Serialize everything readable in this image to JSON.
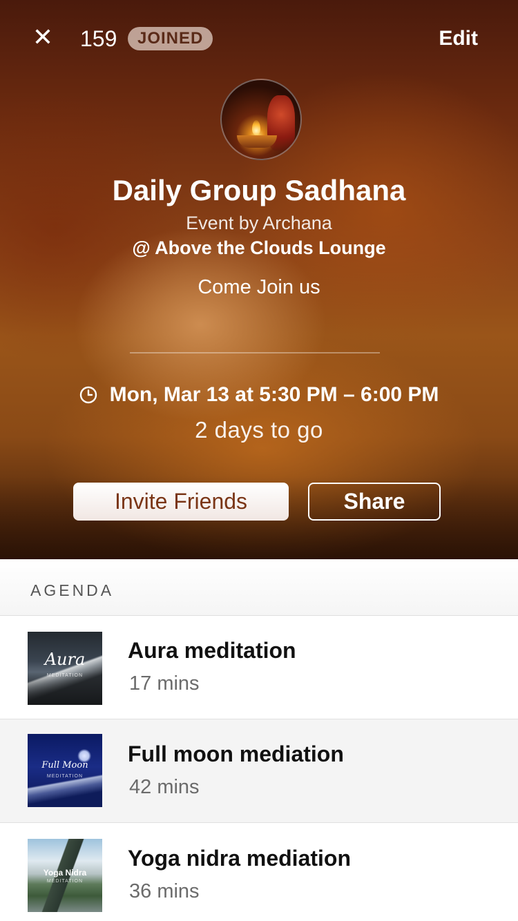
{
  "header": {
    "close_glyph": "✕",
    "member_count": "159",
    "joined_label": "JOINED",
    "edit_label": "Edit"
  },
  "event": {
    "title": "Daily Group Sadhana",
    "by_line": "Event by Archana",
    "location": "@ Above the Clouds Lounge",
    "description": "Come Join us",
    "datetime": "Mon, Mar 13 at 5:30 PM – 6:00 PM",
    "countdown": "2 days to go"
  },
  "actions": {
    "invite_label": "Invite Friends",
    "share_label": "Share"
  },
  "agenda": {
    "heading": "AGENDA",
    "items": [
      {
        "title": "Aura meditation",
        "duration": "17 mins",
        "thumb_text": "Aura",
        "thumb_sub": "MEDITATION"
      },
      {
        "title": "Full moon mediation",
        "duration": "42 mins",
        "thumb_text": "Full Moon",
        "thumb_sub": "MEDITATION"
      },
      {
        "title": "Yoga nidra mediation",
        "duration": "36 mins",
        "thumb_text": "Yoga Nidra",
        "thumb_sub": "MEDITATION"
      }
    ]
  },
  "colors": {
    "invite_text": "#7a3516",
    "joined_badge_text": "#5a2a18",
    "duration_text": "#6b6b6b",
    "selected_row_bg": "#f4f4f4"
  }
}
